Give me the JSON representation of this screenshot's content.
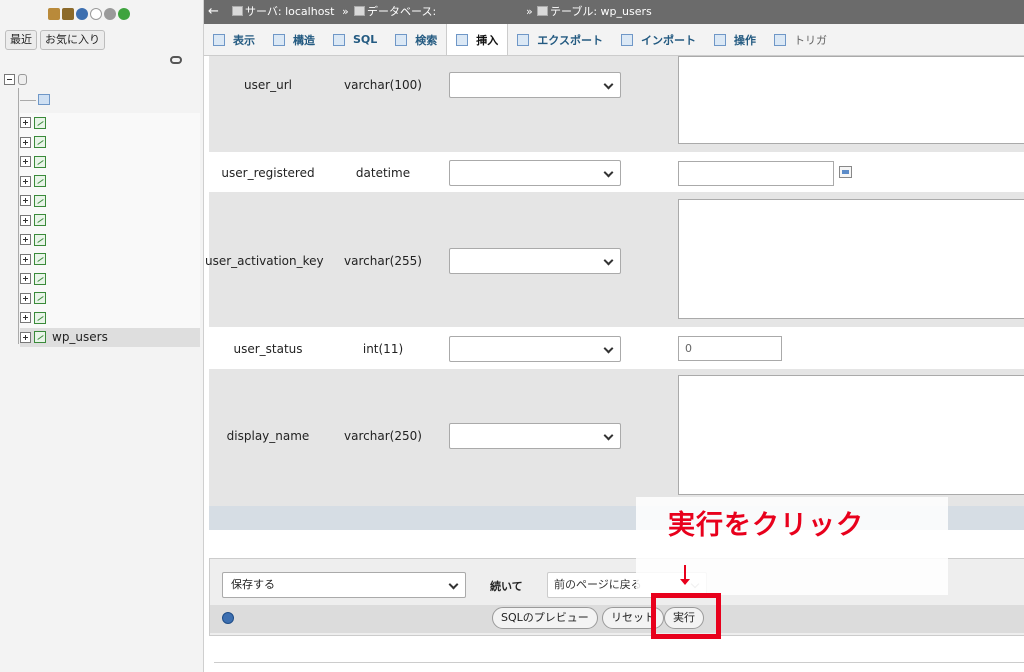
{
  "nav": {
    "recent_label": "最近",
    "favorites_label": "お気に入り",
    "tables": [
      {
        "name": "",
        "active": false
      },
      {
        "name": "",
        "active": false
      },
      {
        "name": "",
        "active": false
      },
      {
        "name": "",
        "active": false
      },
      {
        "name": "",
        "active": false
      },
      {
        "name": "",
        "active": false
      },
      {
        "name": "",
        "active": false
      },
      {
        "name": "",
        "active": false
      },
      {
        "name": "",
        "active": false
      },
      {
        "name": "",
        "active": false
      },
      {
        "name": "",
        "active": false
      },
      {
        "name": "wp_users",
        "active": true
      }
    ]
  },
  "breadcrumb": {
    "server": "サーバ: localhost",
    "database": "データベース:",
    "table": "テーブル: wp_users",
    "separator": "»"
  },
  "tabs": [
    {
      "label": "表示"
    },
    {
      "label": "構造"
    },
    {
      "label": "SQL"
    },
    {
      "label": "検索"
    },
    {
      "label": "挿入",
      "active": true
    },
    {
      "label": "エクスポート"
    },
    {
      "label": "インポート"
    },
    {
      "label": "操作"
    },
    {
      "label": "トリガ"
    }
  ],
  "fields": [
    {
      "name": "user_url",
      "type": "varchar(100)"
    },
    {
      "name": "user_registered",
      "type": "datetime"
    },
    {
      "name": "user_activation_key",
      "type": "varchar(255)"
    },
    {
      "name": "user_status",
      "type": "int(11)",
      "value": "0"
    },
    {
      "name": "display_name",
      "type": "varchar(250)"
    }
  ],
  "actions": {
    "after_insert": "保存する",
    "continue_label": "続いて",
    "continue_option": "前のページに戻る",
    "preview_button": "SQLのプレビュー",
    "reset_button": "リセット",
    "go_button": "実行"
  },
  "annotation": {
    "text": "実行をクリック",
    "color": "#e8001c"
  },
  "colors": {
    "topbar": "#6b6b6b",
    "grey_row": "#e5e5e5",
    "band": "#d6dde4",
    "tab_text": "#235a81"
  }
}
